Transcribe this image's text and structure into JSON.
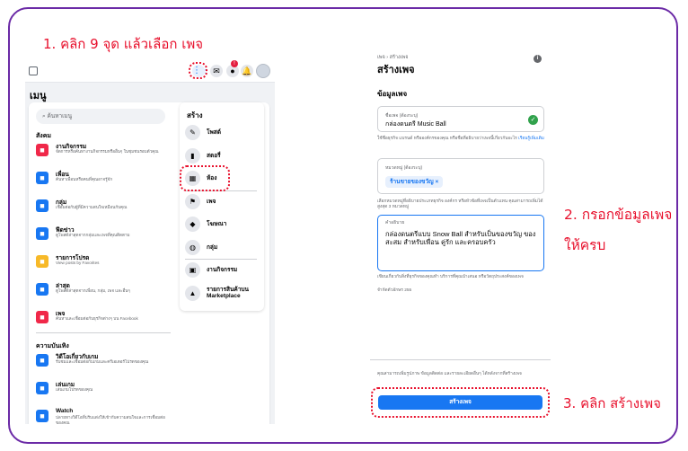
{
  "steps": {
    "step1": "1. คลิก 9 จุด แล้วเลือก เพจ",
    "step2": "2. กรอกข้อมูลเพจให้ครบ",
    "step3": "3. คลิก สร้างเพจ"
  },
  "colors": {
    "annotation": "#e8112d",
    "frame": "#6b2aa6",
    "primary": "#1877f2"
  },
  "left_screen": {
    "menu_title": "เมนู",
    "search_placeholder": "ค้นหาเมนู",
    "social_header": "สังคม",
    "social_items": [
      {
        "icon": "calendar-star-icon",
        "color": "#f02849",
        "title": "งานกิจกรรม",
        "desc": "จัดการหรือค้นหางานกิจกรรมหรืออื่นๆ ในชุมชนรอบตัวคุณ"
      },
      {
        "icon": "friends-icon",
        "color": "#1877f2",
        "title": "เพื่อน",
        "desc": "ค้นหาเพื่อนหรือคนที่คุณอาจรู้จัก"
      },
      {
        "icon": "groups-icon",
        "color": "#1877f2",
        "title": "กลุ่ม",
        "desc": "เชื่อมต่อกับผู้ที่มีความสนใจเหมือนกับคุณ"
      },
      {
        "icon": "news-feed-icon",
        "color": "#1877f2",
        "title": "ฟีดข่าว",
        "desc": "ดูโพสต์ล่าสุดจากกลุ่มและเพจที่คุณติดตาม"
      },
      {
        "icon": "star-icon",
        "color": "#f7b928",
        "title": "รายการโปรด",
        "desc": "View posts by Favorites"
      },
      {
        "icon": "recent-icon",
        "color": "#1877f2",
        "title": "ล่าสุด",
        "desc": "ดูโพสต์ล่าสุดจากเพื่อน, กลุ่ม, เพจ และอื่นๆ"
      },
      {
        "icon": "flag-icon",
        "color": "#f02849",
        "title": "เพจ",
        "desc": "ค้นหาและเชื่อมต่อกับธุรกิจต่างๆ บน Facebook"
      }
    ],
    "entertainment_header": "ความบันเทิง",
    "entertainment_items": [
      {
        "icon": "video-game-icon",
        "color": "#1877f2",
        "title": "วิดีโอเกี่ยวกับเกม",
        "desc": "รับชมและเชื่อมต่อกับเกมและครีเอเตอร์โปรดของคุณ"
      },
      {
        "icon": "gamepad-icon",
        "color": "#1877f2",
        "title": "เล่นเกม",
        "desc": "เล่นเกมโปรดของคุณ"
      },
      {
        "icon": "watch-icon",
        "color": "#1877f2",
        "title": "Watch",
        "desc": "ปลายทางวิดีโอที่ปรับแต่งให้เข้ากับความสนใจและการเชื่อมต่อของคุณ"
      }
    ],
    "create_title": "สร้าง",
    "create_items": [
      {
        "icon": "post-icon",
        "label": "โพสต์"
      },
      {
        "icon": "story-icon",
        "label": "สตอรี่"
      },
      {
        "icon": "room-icon",
        "label": "ห้อง"
      },
      {
        "icon": "page-flag-icon",
        "label": "เพจ"
      },
      {
        "icon": "ad-icon",
        "label": "โฆษณา"
      },
      {
        "icon": "group-icon",
        "label": "กลุ่ม"
      },
      {
        "icon": "event-icon",
        "label": "งานกิจกรรม"
      },
      {
        "icon": "marketplace-icon",
        "label": "รายการสินค้าบน Marketplace"
      }
    ]
  },
  "right_screen": {
    "breadcrumb": "เพจ › สร้างเพจ",
    "title": "สร้างเพจ",
    "section_title": "ข้อมูลเพจ",
    "name_label": "ชื่อเพจ (ต้องระบุ)",
    "name_value": "กล่องดนตรี Music Ball",
    "name_hint": "ใช้ชื่อธุรกิจ แบรนด์ หรือองค์กรของคุณ หรือชื่อที่อธิบายว่าเพจนี้เกี่ยวกับอะไร",
    "name_hint_link": "เรียนรู้เพิ่มเติม",
    "category_label": "หมวดหมู่ (ต้องระบุ)",
    "category_value": "ร้านขายของขวัญ",
    "category_hint": "เลือกหมวดหมู่ที่อธิบายประเภทธุรกิจ องค์กร หรือหัวข้อที่เพจเป็นตัวแทน คุณสามารถเพิ่มได้สูงสุด 3 หมวดหมู่",
    "desc_label": "คำอธิบาย",
    "desc_value": "กล่องดนตรีแบบ Snow Ball สำหรับเป็นของขวัญ ของสะสม สำหรับเพื่อน คู่รัก และครอบครัว",
    "desc_hint": "เขียนเกี่ยวกับสิ่งที่ธุรกิจของคุณทำ บริการที่คุณนำเสนอ หรือวัตถุประสงค์ของเพจ",
    "desc_limit": "จำกัดตัวอักษร 255",
    "footer_hint": "คุณสามารถเพิ่มรูปภาพ ข้อมูลติดต่อ และรายละเอียดอื่นๆ ได้หลังจากที่สร้างเพจ",
    "create_button": "สร้างเพจ"
  }
}
